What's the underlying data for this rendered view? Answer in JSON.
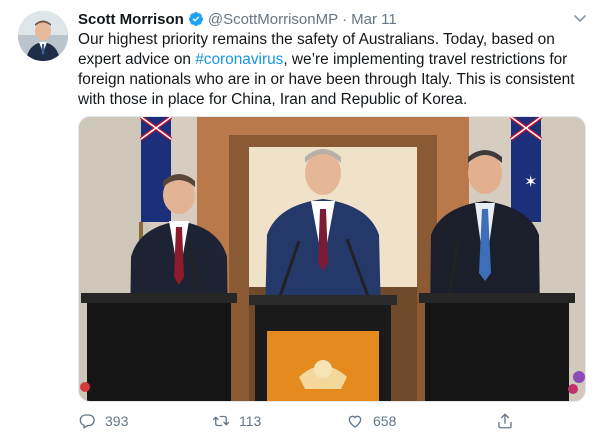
{
  "tweet": {
    "author_name": "Scott Morrison",
    "handle": "@ScottMorrisonMP",
    "separator": "·",
    "date": "Mar 11",
    "text_parts": {
      "before": "Our highest priority remains the safety of Australians. Today, based on expert advice on ",
      "hashtag": "#coronavirus",
      "after": ", we’re implementing travel restrictions for foreign nationals who are in or have been through Italy. This is consistent with those in place for China, Iran and Republic of Korea."
    },
    "stats": {
      "replies": "393",
      "retweets": "113",
      "likes": "658"
    }
  },
  "colors": {
    "link": "#1b95e0",
    "secondary_text": "#657786",
    "verified_badge": "#1da1f2"
  },
  "icons": {
    "verified": "verified-badge-icon",
    "caret": "chevron-down-icon",
    "reply": "reply-bubble-icon",
    "retweet": "retweet-icon",
    "like": "heart-icon",
    "share": "share-icon"
  }
}
